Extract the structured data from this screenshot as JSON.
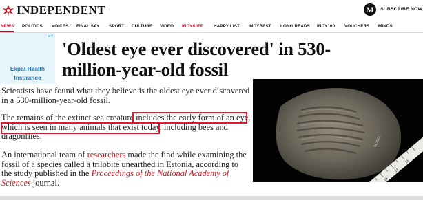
{
  "header": {
    "brand": "INDEPENDENT",
    "profile_letter": "M",
    "subscribe_label": "SUBSCRIBE NOW"
  },
  "nav": {
    "items": [
      "NEWS",
      "POLITICS",
      "VOICES",
      "FINAL SAY",
      "SPORT",
      "CULTURE",
      "VIDEO",
      "INDY/LIFE",
      "HAPPY LIST",
      "INDYBEST",
      "LONG READS",
      "INDY100",
      "VOUCHERS",
      "MINDS"
    ],
    "active": "NEWS",
    "highlighted": "INDY/LIFE"
  },
  "ad": {
    "text_line1": "Expat Health",
    "text_line2": "Insurance",
    "close_glyph": "▸✕"
  },
  "article": {
    "headline_line1": "'Oldest eye ever discovered' in 530-",
    "headline_line2": "million-year-old fossil",
    "p1": "Scientists have found what they believe is the oldest eye ever discovered in a 530-million-year-old fossil.",
    "p2_part1": "The remains of the extinct sea creature ",
    "p2_part2": "includes the early form of an eye, which is seen in many animals that exist today",
    "p2_part3": ", including bees and dragonflies.",
    "p3_part1": "An international team of ",
    "p3_link": "researchers",
    "p3_part2": " made the find while examining the fossil of a species called a trilobite unearthed in Estonia, according to the study published in the ",
    "p3_journal": "Proceedings of the National Academy of Sciences",
    "p3_part3": " journal."
  },
  "photo": {
    "ruler_marks": [
      "12",
      "13",
      "14",
      "15"
    ]
  },
  "colors": {
    "accent_red": "#d0021b",
    "link_red": "#c5161d",
    "highlight_box": "#e0182d",
    "ad_bg": "#e7f5fc",
    "ad_text": "#2277bb"
  }
}
